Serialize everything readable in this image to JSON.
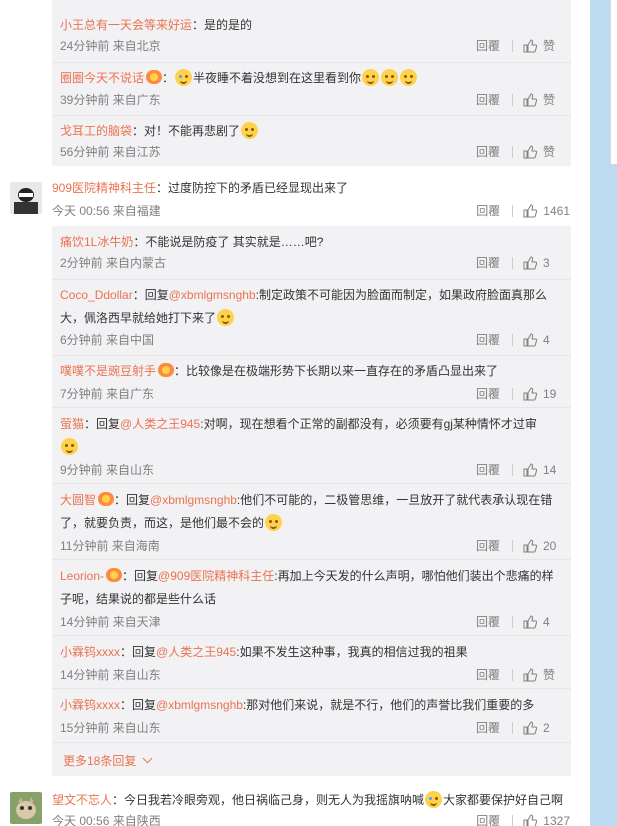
{
  "sub_comments_1": [
    {
      "user": "小王总有一天会等来好运",
      "text": "：是的是的",
      "emojis": "",
      "meta": "24分钟前 来自北京",
      "likes": "赞"
    },
    {
      "user": "圈圈今天不说话",
      "text": "半夜睡不着没想到在这里看到你",
      "meta": "39分钟前 来自广东",
      "likes": "赞"
    },
    {
      "user": "戈耳工的脑袋",
      "text": "：对！不能再悲剧了",
      "meta": "56分钟前 来自江苏",
      "likes": "赞"
    }
  ],
  "main_comment_1": {
    "user": "909医院精神科主任",
    "text": "：过度防控下的矛盾已经显现出来了",
    "meta": "今天 00:56 来自福建",
    "likes": "1461"
  },
  "sub_comments_2": [
    {
      "user": "痛饮1L冰牛奶",
      "text": "：不能说是防疫了 其实就是……吧?",
      "meta": "2分钟前 来自内蒙古",
      "likes": "3"
    },
    {
      "user": "Coco_Ddollar",
      "prefix": "：回复",
      "mention": "@xbmlgmsnghb",
      "text": ":制定政策不可能因为脸面而制定，如果政府脸面真那么大，佩洛西早就给她打下来了",
      "meta": "6分钟前 来自中国",
      "likes": "4"
    },
    {
      "user": "噗噗不是豌豆射手",
      "text": "：比较像是在极端形势下长期以来一直存在的矛盾凸显出来了",
      "meta": "7分钟前 来自广东",
      "likes": "19"
    },
    {
      "user": "萤猫",
      "prefix": "：回复",
      "mention": "@人类之王945",
      "text": ":对啊，现在想看个正常的副都没有，必须要有gj某种情怀才过审",
      "meta": "9分钟前 来自山东",
      "likes": "14"
    },
    {
      "user": "大圆智",
      "prefix": "：回复",
      "mention": "@xbmlgmsnghb",
      "text": ":他们不可能的，二极管思维，一旦放开了就代表承认现在错了，就要负责，而这，是他们最不会的",
      "meta": "11分钟前 来自海南",
      "likes": "20"
    },
    {
      "user": "Leorion-",
      "prefix": "：回复",
      "mention": "@909医院精神科主任",
      "text": ":再加上今天发的什么声明，哪怕他们装出个悲痛的样子呢，结果说的都是些什么话",
      "meta": "14分钟前 来自天津",
      "likes": "4"
    },
    {
      "user": "小霖钨xxxx",
      "prefix": "：回复",
      "mention": "@人类之王945",
      "text": ":如果不发生这种事，我真的相信过我的祖果",
      "meta": "14分钟前 来自山东",
      "likes": "赞"
    },
    {
      "user": "小霖钨xxxx",
      "prefix": "：回复",
      "mention": "@xbmlgmsnghb",
      "text": ":那对他们来说，就是不行，他们的声誉比我们重要的多",
      "meta": "15分钟前 来自山东",
      "likes": "2"
    }
  ],
  "more_replies": "更多18条回复",
  "main_comment_2": {
    "user": "望文不忘人",
    "text": "：今日我若冷眼旁观，他日祸临己身，则无人为我摇旗呐喊",
    "text2": "大家都要保护好自己啊",
    "meta": "今天 00:56 来自陕西",
    "likes": "1327"
  },
  "reply_label": "回覆",
  "icons": {
    "like": "thumbs-up-icon",
    "expand": "chevron-down-icon"
  },
  "colors": {
    "username": "#eb7350",
    "meta": "#808080",
    "sub_bg": "#f2f2f5",
    "right_bg": "#bcdaf0"
  }
}
